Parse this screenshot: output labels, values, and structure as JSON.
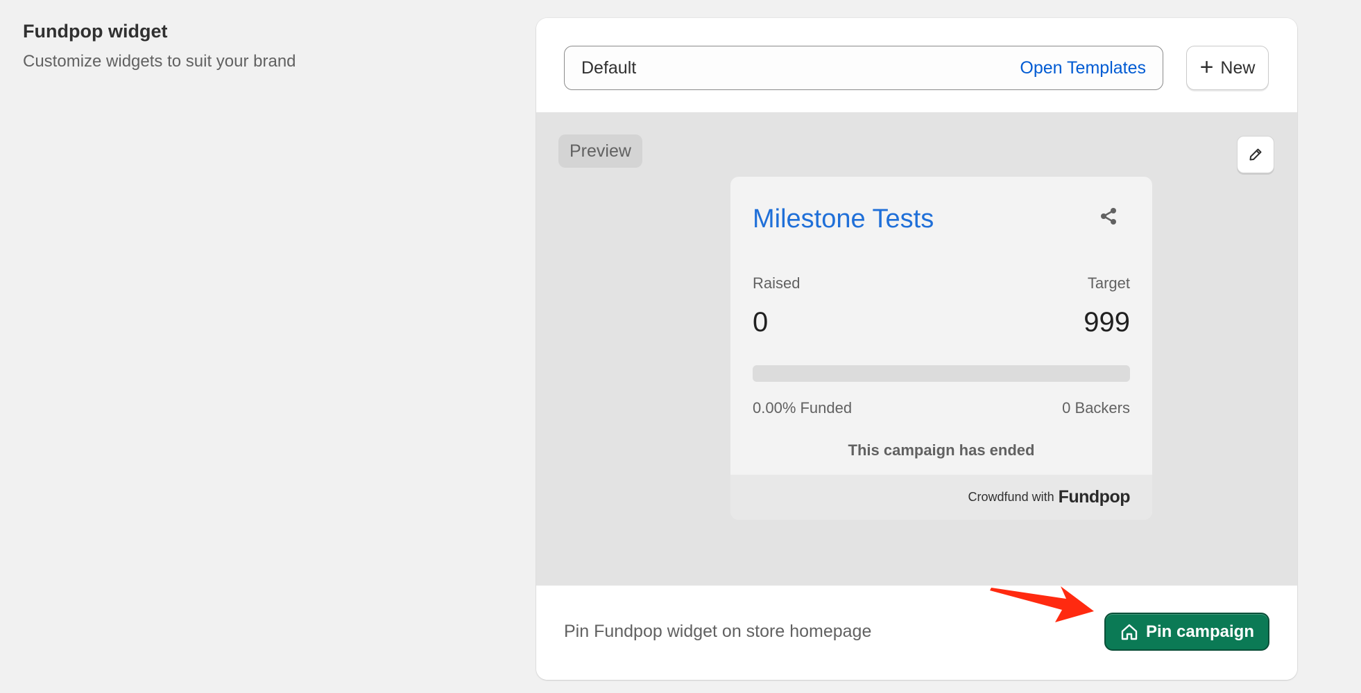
{
  "section": {
    "title": "Fundpop widget",
    "subtitle": "Customize widgets to suit your brand"
  },
  "template_selector": {
    "value": "Default",
    "open_label": "Open Templates"
  },
  "new_button": {
    "label": "New",
    "icon": "plus-icon"
  },
  "preview": {
    "badge": "Preview",
    "edit_icon": "pencil-icon"
  },
  "widget": {
    "title": "Milestone Tests",
    "share_icon": "share-icon",
    "raised_label": "Raised",
    "target_label": "Target",
    "raised_value": "0",
    "target_value": "999",
    "progress_fraction": 0,
    "funded_text": "0.00% Funded",
    "backers_text": "0 Backers",
    "status_text": "This campaign has ended",
    "powered_text": "Crowdfund with",
    "brand": "Fundpop"
  },
  "pin": {
    "text": "Pin Fundpop widget on store homepage",
    "button_label": "Pin campaign",
    "button_icon": "home-icon"
  },
  "colors": {
    "accent_link": "#005bd3",
    "widget_title": "#1f6fd8",
    "primary_button": "#0b7a55",
    "annotation_arrow": "#ff2a10"
  }
}
